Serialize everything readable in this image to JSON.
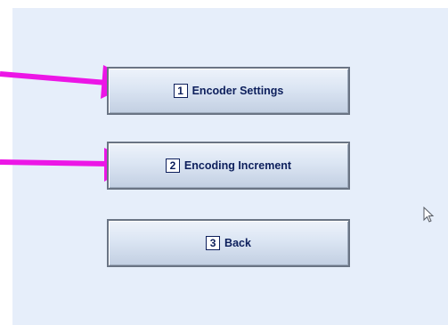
{
  "menu": {
    "buttons": [
      {
        "key": "1",
        "label": "Encoder Settings"
      },
      {
        "key": "2",
        "label": "Encoding Increment"
      },
      {
        "key": "3",
        "label": "Back"
      }
    ]
  },
  "annotations": {
    "arrow_color": "#ec16e6",
    "arrow_icon": "arrow-right-icon"
  },
  "colors": {
    "panel_background": "#e6eefa",
    "button_text": "#0d1f5c"
  },
  "cursor_icon": "mouse-pointer-icon"
}
